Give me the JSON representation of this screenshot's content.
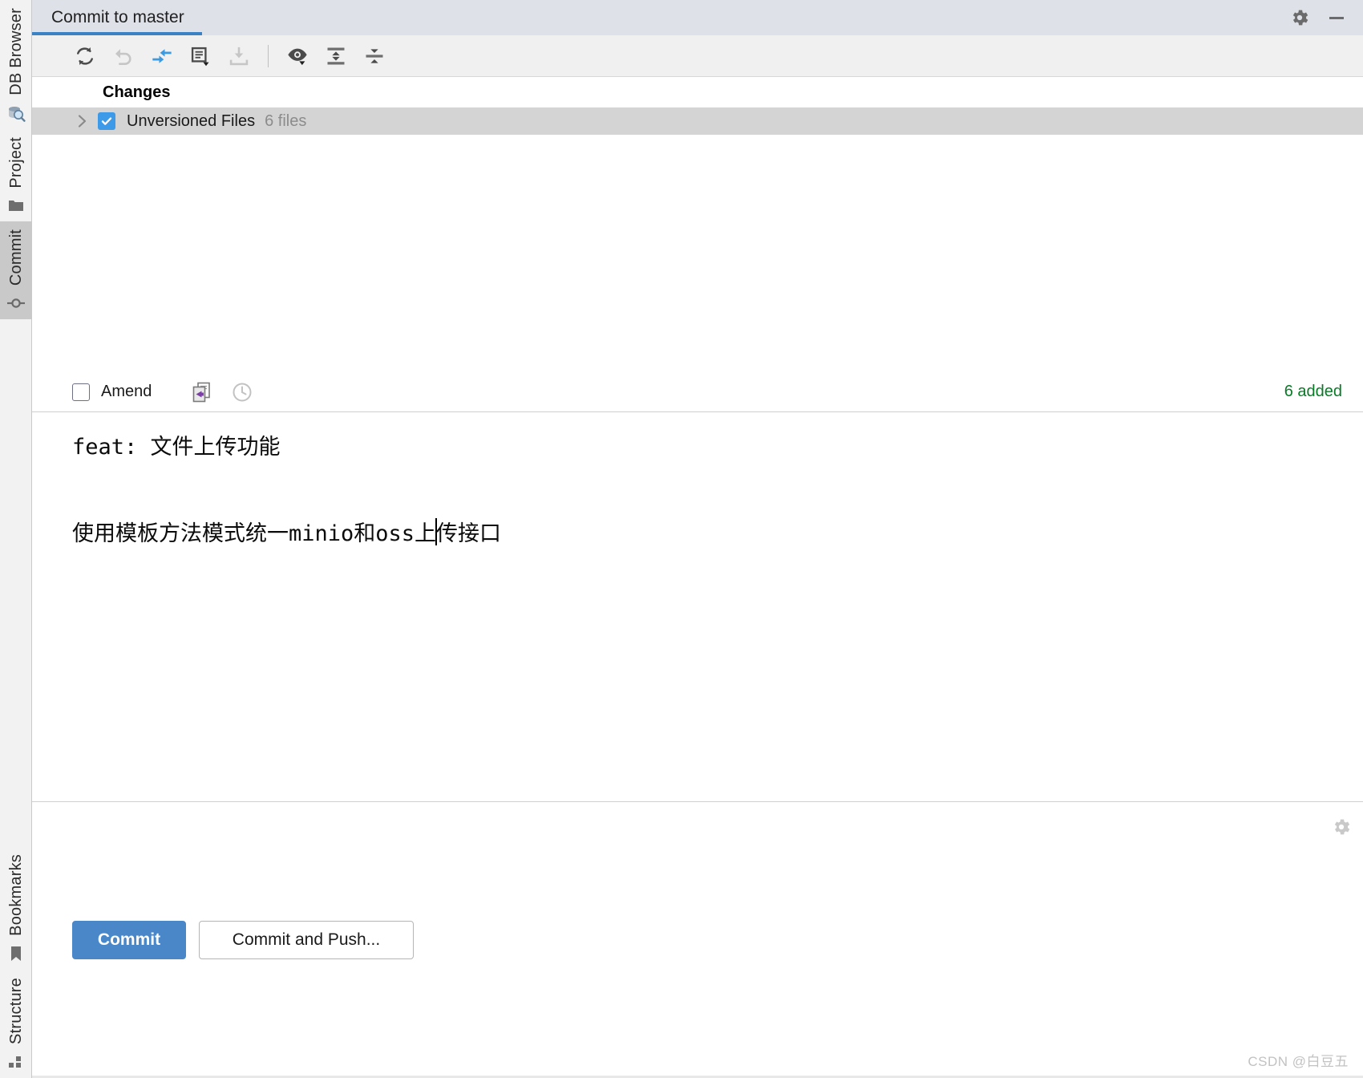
{
  "window": {
    "title_tab": "Commit to master",
    "settings_icon": "gear-icon",
    "minimize_icon": "minimize-icon",
    "accent_color": "#3b82c4"
  },
  "tool_strip": {
    "top_tabs": [
      {
        "label": "DB Browser",
        "icon": "database-browser-icon",
        "active": false
      },
      {
        "label": "Project",
        "icon": "folder-icon",
        "active": false
      },
      {
        "label": "Commit",
        "icon": "commit-node-icon",
        "active": true
      }
    ],
    "bottom_tabs": [
      {
        "label": "Bookmarks",
        "icon": "bookmark-icon",
        "active": false
      },
      {
        "label": "Structure",
        "icon": "structure-grid-icon",
        "active": false
      }
    ]
  },
  "toolbar": {
    "buttons": [
      {
        "name": "refresh-changes-button",
        "icon": "refresh-icon",
        "enabled": true
      },
      {
        "name": "rollback-button",
        "icon": "undo-arrow-icon",
        "enabled": false
      },
      {
        "name": "show-diff-button",
        "icon": "diff-arrows-icon",
        "enabled": true
      },
      {
        "name": "group-by-button",
        "icon": "document-dropdown-icon",
        "enabled": true
      },
      {
        "name": "update-project-button",
        "icon": "download-tray-icon",
        "enabled": false
      },
      {
        "name": "preview-diff-button",
        "icon": "eye-dropdown-icon",
        "enabled": true
      },
      {
        "name": "expand-all-button",
        "icon": "expand-all-icon",
        "enabled": true
      },
      {
        "name": "collapse-all-button",
        "icon": "collapse-all-icon",
        "enabled": true
      }
    ]
  },
  "changes": {
    "header": "Changes",
    "rows": [
      {
        "label": "Unversioned Files",
        "count": "6 files",
        "checked": true,
        "expanded": false
      }
    ]
  },
  "amend_bar": {
    "checkbox_label": "Amend",
    "checked": false,
    "icons": [
      {
        "name": "commit-message-history-icon"
      },
      {
        "name": "clock-history-icon"
      }
    ],
    "added_status": "6 added",
    "added_color": "#0a7a27"
  },
  "commit_message": {
    "subject": "feat: 文件上传功能",
    "body_before_caret": "使用模板方法模式统一minio和oss上",
    "body_after_caret": "传接口",
    "placeholder": "Commit Message"
  },
  "actions": {
    "commit_label": "Commit",
    "commit_and_push_label": "Commit and Push...",
    "settings_icon": "gear-icon"
  },
  "watermark": {
    "text": "CSDN @白豆五"
  }
}
